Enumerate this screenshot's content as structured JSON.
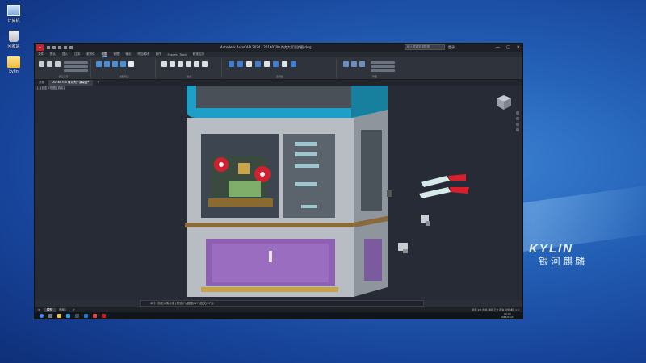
{
  "desktop": {
    "icons": [
      {
        "label": "计算机",
        "icon": "computer-icon"
      },
      {
        "label": "回收站",
        "icon": "recycle-bin-icon"
      },
      {
        "label": "kylin",
        "icon": "folder-icon"
      }
    ],
    "brand_en": "KYLIN",
    "brand_cn": "银河麒麟"
  },
  "window": {
    "app_badge": "A",
    "title": "Autodesk AutoCAD 2024  -  20160700 商务大厅渲染图.dwg",
    "search_placeholder": "键入关键字或短语",
    "user": "登录",
    "controls": [
      "—",
      "□",
      "✕"
    ]
  },
  "menu": {
    "items": [
      "文件",
      "默认",
      "插入",
      "注释",
      "参数化",
      "视图",
      "管理",
      "输出",
      "附加模块",
      "协作",
      "Express Tools",
      "精选应用"
    ],
    "active_index": 5
  },
  "ribbon": {
    "groups": [
      "视口工具",
      "模型视口",
      "坐标",
      "选项板",
      "界面"
    ]
  },
  "tabs": {
    "items": [
      "开始",
      "20160700 商务大厅渲染图*"
    ],
    "active_index": 1
  },
  "viewport": {
    "label": "[-][自定义视图][真实]"
  },
  "command": {
    "text": "命令: 指定对角点或 [栏选(F)/圈围(WP)/圈交(CP)]:",
    "prompt": "键入命令"
  },
  "status": {
    "tabs": [
      "模型",
      "布局1"
    ],
    "active_index": 0,
    "right_text": "模型 ## 栅格 捕捉 正交 极轴 对象捕捉 1:1"
  },
  "taskbar": {
    "time": "10:30",
    "date": "2024/01/23"
  },
  "colors": {
    "cabinet_teal": "#1fa0c6",
    "cabinet_gray": "#b7bcc2",
    "panel_purple": "#8d5fb0",
    "accent_red": "#d8202c"
  }
}
